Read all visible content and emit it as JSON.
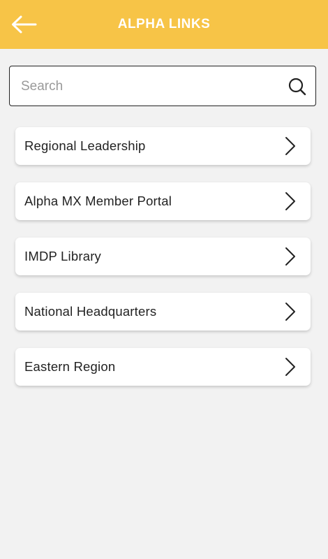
{
  "header": {
    "title": "ALPHA LINKS",
    "background_color": "#f7c447",
    "back_icon": "arrow-left-icon"
  },
  "search": {
    "placeholder": "Search",
    "value": "",
    "icon": "search-icon"
  },
  "links": [
    {
      "label": "Regional Leadership",
      "icon": "chevron-right-icon"
    },
    {
      "label": "Alpha MX Member Portal",
      "icon": "chevron-right-icon"
    },
    {
      "label": "IMDP Library",
      "icon": "chevron-right-icon"
    },
    {
      "label": "National Headquarters",
      "icon": "chevron-right-icon"
    },
    {
      "label": "Eastern Region",
      "icon": "chevron-right-icon"
    }
  ]
}
